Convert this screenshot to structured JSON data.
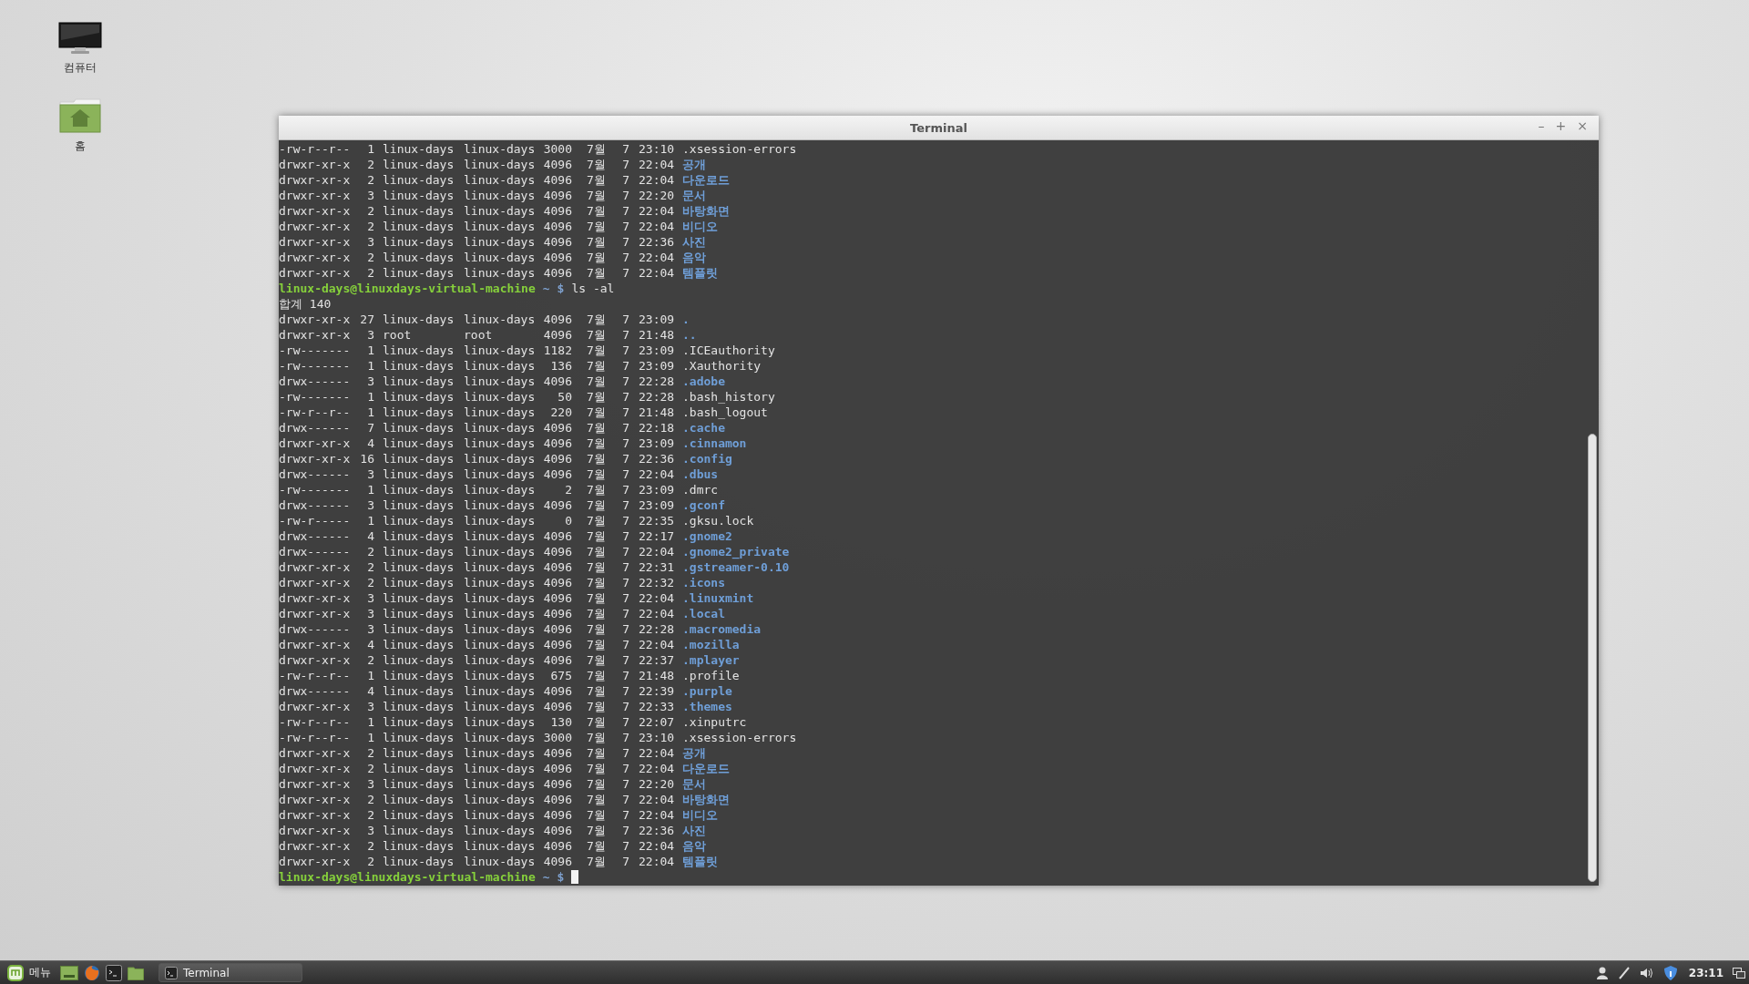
{
  "desktop": {
    "icons": [
      {
        "kind": "computer",
        "label": "컴퓨터"
      },
      {
        "kind": "home",
        "label": "홈"
      }
    ]
  },
  "window": {
    "title": "Terminal",
    "controls": [
      "–",
      "+",
      "×"
    ]
  },
  "terminal": {
    "lines": [
      {
        "kind": "entry",
        "perms": "-rw-r--r--",
        "links": "1",
        "owner": "linux-days",
        "group": "linux-days",
        "size": "3000",
        "month": "7월",
        "day": "7",
        "time": "23:10",
        "name": ".xsession-errors",
        "directory": false
      },
      {
        "kind": "entry",
        "perms": "drwxr-xr-x",
        "links": "2",
        "owner": "linux-days",
        "group": "linux-days",
        "size": "4096",
        "month": "7월",
        "day": "7",
        "time": "22:04",
        "name": "공개",
        "directory": true
      },
      {
        "kind": "entry",
        "perms": "drwxr-xr-x",
        "links": "2",
        "owner": "linux-days",
        "group": "linux-days",
        "size": "4096",
        "month": "7월",
        "day": "7",
        "time": "22:04",
        "name": "다운로드",
        "directory": true
      },
      {
        "kind": "entry",
        "perms": "drwxr-xr-x",
        "links": "3",
        "owner": "linux-days",
        "group": "linux-days",
        "size": "4096",
        "month": "7월",
        "day": "7",
        "time": "22:20",
        "name": "문서",
        "directory": true
      },
      {
        "kind": "entry",
        "perms": "drwxr-xr-x",
        "links": "2",
        "owner": "linux-days",
        "group": "linux-days",
        "size": "4096",
        "month": "7월",
        "day": "7",
        "time": "22:04",
        "name": "바탕화면",
        "directory": true
      },
      {
        "kind": "entry",
        "perms": "drwxr-xr-x",
        "links": "2",
        "owner": "linux-days",
        "group": "linux-days",
        "size": "4096",
        "month": "7월",
        "day": "7",
        "time": "22:04",
        "name": "비디오",
        "directory": true
      },
      {
        "kind": "entry",
        "perms": "drwxr-xr-x",
        "links": "3",
        "owner": "linux-days",
        "group": "linux-days",
        "size": "4096",
        "month": "7월",
        "day": "7",
        "time": "22:36",
        "name": "사진",
        "directory": true
      },
      {
        "kind": "entry",
        "perms": "drwxr-xr-x",
        "links": "2",
        "owner": "linux-days",
        "group": "linux-days",
        "size": "4096",
        "month": "7월",
        "day": "7",
        "time": "22:04",
        "name": "음악",
        "directory": true
      },
      {
        "kind": "entry",
        "perms": "drwxr-xr-x",
        "links": "2",
        "owner": "linux-days",
        "group": "linux-days",
        "size": "4096",
        "month": "7월",
        "day": "7",
        "time": "22:04",
        "name": "템플릿",
        "directory": true
      },
      {
        "kind": "prompt",
        "user_host": "linux-days@linuxdays-virtual-machine",
        "path": "~",
        "symbol": "$",
        "command": "ls -al",
        "cursor": false
      },
      {
        "kind": "total",
        "text": "합계 140"
      },
      {
        "kind": "entry",
        "perms": "drwxr-xr-x",
        "links": "27",
        "owner": "linux-days",
        "group": "linux-days",
        "size": "4096",
        "month": "7월",
        "day": "7",
        "time": "23:09",
        "name": ".",
        "directory": true
      },
      {
        "kind": "entry",
        "perms": "drwxr-xr-x",
        "links": "3",
        "owner": "root",
        "group": "root",
        "size": "4096",
        "month": "7월",
        "day": "7",
        "time": "21:48",
        "name": "..",
        "directory": true
      },
      {
        "kind": "entry",
        "perms": "-rw-------",
        "links": "1",
        "owner": "linux-days",
        "group": "linux-days",
        "size": "1182",
        "month": "7월",
        "day": "7",
        "time": "23:09",
        "name": ".ICEauthority",
        "directory": false
      },
      {
        "kind": "entry",
        "perms": "-rw-------",
        "links": "1",
        "owner": "linux-days",
        "group": "linux-days",
        "size": "136",
        "month": "7월",
        "day": "7",
        "time": "23:09",
        "name": ".Xauthority",
        "directory": false
      },
      {
        "kind": "entry",
        "perms": "drwx------",
        "links": "3",
        "owner": "linux-days",
        "group": "linux-days",
        "size": "4096",
        "month": "7월",
        "day": "7",
        "time": "22:28",
        "name": ".adobe",
        "directory": true
      },
      {
        "kind": "entry",
        "perms": "-rw-------",
        "links": "1",
        "owner": "linux-days",
        "group": "linux-days",
        "size": "50",
        "month": "7월",
        "day": "7",
        "time": "22:28",
        "name": ".bash_history",
        "directory": false
      },
      {
        "kind": "entry",
        "perms": "-rw-r--r--",
        "links": "1",
        "owner": "linux-days",
        "group": "linux-days",
        "size": "220",
        "month": "7월",
        "day": "7",
        "time": "21:48",
        "name": ".bash_logout",
        "directory": false
      },
      {
        "kind": "entry",
        "perms": "drwx------",
        "links": "7",
        "owner": "linux-days",
        "group": "linux-days",
        "size": "4096",
        "month": "7월",
        "day": "7",
        "time": "22:18",
        "name": ".cache",
        "directory": true
      },
      {
        "kind": "entry",
        "perms": "drwxr-xr-x",
        "links": "4",
        "owner": "linux-days",
        "group": "linux-days",
        "size": "4096",
        "month": "7월",
        "day": "7",
        "time": "23:09",
        "name": ".cinnamon",
        "directory": true
      },
      {
        "kind": "entry",
        "perms": "drwxr-xr-x",
        "links": "16",
        "owner": "linux-days",
        "group": "linux-days",
        "size": "4096",
        "month": "7월",
        "day": "7",
        "time": "22:36",
        "name": ".config",
        "directory": true
      },
      {
        "kind": "entry",
        "perms": "drwx------",
        "links": "3",
        "owner": "linux-days",
        "group": "linux-days",
        "size": "4096",
        "month": "7월",
        "day": "7",
        "time": "22:04",
        "name": ".dbus",
        "directory": true
      },
      {
        "kind": "entry",
        "perms": "-rw-------",
        "links": "1",
        "owner": "linux-days",
        "group": "linux-days",
        "size": "2",
        "month": "7월",
        "day": "7",
        "time": "23:09",
        "name": ".dmrc",
        "directory": false
      },
      {
        "kind": "entry",
        "perms": "drwx------",
        "links": "3",
        "owner": "linux-days",
        "group": "linux-days",
        "size": "4096",
        "month": "7월",
        "day": "7",
        "time": "23:09",
        "name": ".gconf",
        "directory": true
      },
      {
        "kind": "entry",
        "perms": "-rw-r-----",
        "links": "1",
        "owner": "linux-days",
        "group": "linux-days",
        "size": "0",
        "month": "7월",
        "day": "7",
        "time": "22:35",
        "name": ".gksu.lock",
        "directory": false
      },
      {
        "kind": "entry",
        "perms": "drwx------",
        "links": "4",
        "owner": "linux-days",
        "group": "linux-days",
        "size": "4096",
        "month": "7월",
        "day": "7",
        "time": "22:17",
        "name": ".gnome2",
        "directory": true
      },
      {
        "kind": "entry",
        "perms": "drwx------",
        "links": "2",
        "owner": "linux-days",
        "group": "linux-days",
        "size": "4096",
        "month": "7월",
        "day": "7",
        "time": "22:04",
        "name": ".gnome2_private",
        "directory": true
      },
      {
        "kind": "entry",
        "perms": "drwxr-xr-x",
        "links": "2",
        "owner": "linux-days",
        "group": "linux-days",
        "size": "4096",
        "month": "7월",
        "day": "7",
        "time": "22:31",
        "name": ".gstreamer-0.10",
        "directory": true
      },
      {
        "kind": "entry",
        "perms": "drwxr-xr-x",
        "links": "2",
        "owner": "linux-days",
        "group": "linux-days",
        "size": "4096",
        "month": "7월",
        "day": "7",
        "time": "22:32",
        "name": ".icons",
        "directory": true
      },
      {
        "kind": "entry",
        "perms": "drwxr-xr-x",
        "links": "3",
        "owner": "linux-days",
        "group": "linux-days",
        "size": "4096",
        "month": "7월",
        "day": "7",
        "time": "22:04",
        "name": ".linuxmint",
        "directory": true
      },
      {
        "kind": "entry",
        "perms": "drwxr-xr-x",
        "links": "3",
        "owner": "linux-days",
        "group": "linux-days",
        "size": "4096",
        "month": "7월",
        "day": "7",
        "time": "22:04",
        "name": ".local",
        "directory": true
      },
      {
        "kind": "entry",
        "perms": "drwx------",
        "links": "3",
        "owner": "linux-days",
        "group": "linux-days",
        "size": "4096",
        "month": "7월",
        "day": "7",
        "time": "22:28",
        "name": ".macromedia",
        "directory": true
      },
      {
        "kind": "entry",
        "perms": "drwxr-xr-x",
        "links": "4",
        "owner": "linux-days",
        "group": "linux-days",
        "size": "4096",
        "month": "7월",
        "day": "7",
        "time": "22:04",
        "name": ".mozilla",
        "directory": true
      },
      {
        "kind": "entry",
        "perms": "drwxr-xr-x",
        "links": "2",
        "owner": "linux-days",
        "group": "linux-days",
        "size": "4096",
        "month": "7월",
        "day": "7",
        "time": "22:37",
        "name": ".mplayer",
        "directory": true
      },
      {
        "kind": "entry",
        "perms": "-rw-r--r--",
        "links": "1",
        "owner": "linux-days",
        "group": "linux-days",
        "size": "675",
        "month": "7월",
        "day": "7",
        "time": "21:48",
        "name": ".profile",
        "directory": false
      },
      {
        "kind": "entry",
        "perms": "drwx------",
        "links": "4",
        "owner": "linux-days",
        "group": "linux-days",
        "size": "4096",
        "month": "7월",
        "day": "7",
        "time": "22:39",
        "name": ".purple",
        "directory": true
      },
      {
        "kind": "entry",
        "perms": "drwxr-xr-x",
        "links": "3",
        "owner": "linux-days",
        "group": "linux-days",
        "size": "4096",
        "month": "7월",
        "day": "7",
        "time": "22:33",
        "name": ".themes",
        "directory": true
      },
      {
        "kind": "entry",
        "perms": "-rw-r--r--",
        "links": "1",
        "owner": "linux-days",
        "group": "linux-days",
        "size": "130",
        "month": "7월",
        "day": "7",
        "time": "22:07",
        "name": ".xinputrc",
        "directory": false
      },
      {
        "kind": "entry",
        "perms": "-rw-r--r--",
        "links": "1",
        "owner": "linux-days",
        "group": "linux-days",
        "size": "3000",
        "month": "7월",
        "day": "7",
        "time": "23:10",
        "name": ".xsession-errors",
        "directory": false
      },
      {
        "kind": "entry",
        "perms": "drwxr-xr-x",
        "links": "2",
        "owner": "linux-days",
        "group": "linux-days",
        "size": "4096",
        "month": "7월",
        "day": "7",
        "time": "22:04",
        "name": "공개",
        "directory": true
      },
      {
        "kind": "entry",
        "perms": "drwxr-xr-x",
        "links": "2",
        "owner": "linux-days",
        "group": "linux-days",
        "size": "4096",
        "month": "7월",
        "day": "7",
        "time": "22:04",
        "name": "다운로드",
        "directory": true
      },
      {
        "kind": "entry",
        "perms": "drwxr-xr-x",
        "links": "3",
        "owner": "linux-days",
        "group": "linux-days",
        "size": "4096",
        "month": "7월",
        "day": "7",
        "time": "22:20",
        "name": "문서",
        "directory": true
      },
      {
        "kind": "entry",
        "perms": "drwxr-xr-x",
        "links": "2",
        "owner": "linux-days",
        "group": "linux-days",
        "size": "4096",
        "month": "7월",
        "day": "7",
        "time": "22:04",
        "name": "바탕화면",
        "directory": true
      },
      {
        "kind": "entry",
        "perms": "drwxr-xr-x",
        "links": "2",
        "owner": "linux-days",
        "group": "linux-days",
        "size": "4096",
        "month": "7월",
        "day": "7",
        "time": "22:04",
        "name": "비디오",
        "directory": true
      },
      {
        "kind": "entry",
        "perms": "drwxr-xr-x",
        "links": "3",
        "owner": "linux-days",
        "group": "linux-days",
        "size": "4096",
        "month": "7월",
        "day": "7",
        "time": "22:36",
        "name": "사진",
        "directory": true
      },
      {
        "kind": "entry",
        "perms": "drwxr-xr-x",
        "links": "2",
        "owner": "linux-days",
        "group": "linux-days",
        "size": "4096",
        "month": "7월",
        "day": "7",
        "time": "22:04",
        "name": "음악",
        "directory": true
      },
      {
        "kind": "entry",
        "perms": "drwxr-xr-x",
        "links": "2",
        "owner": "linux-days",
        "group": "linux-days",
        "size": "4096",
        "month": "7월",
        "day": "7",
        "time": "22:04",
        "name": "템플릿",
        "directory": true
      },
      {
        "kind": "prompt",
        "user_host": "linux-days@linuxdays-virtual-machine",
        "path": "~",
        "symbol": "$",
        "cursor": true
      }
    ]
  },
  "taskbar": {
    "menu_label": "메뉴",
    "launchers": [
      {
        "kind": "desktop"
      },
      {
        "kind": "browser"
      },
      {
        "kind": "terminal"
      },
      {
        "kind": "folder"
      }
    ],
    "window_buttons": [
      {
        "label": "Terminal",
        "selected": true
      }
    ],
    "tray": [
      {
        "kind": "user"
      },
      {
        "kind": "pen"
      },
      {
        "kind": "volume"
      },
      {
        "kind": "shield"
      }
    ],
    "clock": "23:11"
  }
}
